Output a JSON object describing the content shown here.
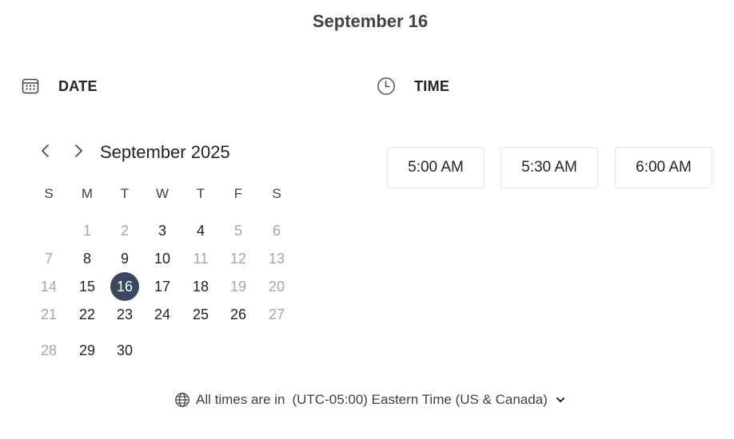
{
  "title": "September 16",
  "date_section": {
    "label": "DATE",
    "icon": "calendar-icon"
  },
  "time_section": {
    "label": "TIME",
    "icon": "clock-icon"
  },
  "calendar": {
    "month_label": "September 2025",
    "prev_icon": "chevron-left-icon",
    "next_icon": "chevron-right-icon",
    "weekdays": [
      "S",
      "M",
      "T",
      "W",
      "T",
      "F",
      "S"
    ],
    "weeks": [
      [
        null,
        {
          "d": "1",
          "s": "unavailable"
        },
        {
          "d": "2",
          "s": "unavailable"
        },
        {
          "d": "3",
          "s": "available"
        },
        {
          "d": "4",
          "s": "available"
        },
        {
          "d": "5",
          "s": "unavailable"
        },
        {
          "d": "6",
          "s": "unavailable"
        }
      ],
      [
        {
          "d": "7",
          "s": "unavailable"
        },
        {
          "d": "8",
          "s": "available"
        },
        {
          "d": "9",
          "s": "available"
        },
        {
          "d": "10",
          "s": "available"
        },
        {
          "d": "11",
          "s": "unavailable"
        },
        {
          "d": "12",
          "s": "unavailable"
        },
        {
          "d": "13",
          "s": "unavailable"
        }
      ],
      [
        {
          "d": "14",
          "s": "unavailable"
        },
        {
          "d": "15",
          "s": "available"
        },
        {
          "d": "16",
          "s": "selected"
        },
        {
          "d": "17",
          "s": "available"
        },
        {
          "d": "18",
          "s": "available"
        },
        {
          "d": "19",
          "s": "unavailable"
        },
        {
          "d": "20",
          "s": "unavailable"
        }
      ],
      [
        {
          "d": "21",
          "s": "unavailable"
        },
        {
          "d": "22",
          "s": "available"
        },
        {
          "d": "23",
          "s": "available"
        },
        {
          "d": "24",
          "s": "available"
        },
        {
          "d": "25",
          "s": "available"
        },
        {
          "d": "26",
          "s": "available"
        },
        {
          "d": "27",
          "s": "unavailable"
        }
      ],
      [
        {
          "d": "28",
          "s": "unavailable"
        },
        {
          "d": "29",
          "s": "available"
        },
        {
          "d": "30",
          "s": "available"
        },
        null,
        null,
        null,
        null
      ]
    ]
  },
  "time_slots": [
    "5:00 AM",
    "5:30 AM",
    "6:00 AM"
  ],
  "timezone": {
    "prefix": "All times are in",
    "value": "(UTC-05:00) Eastern Time (US & Canada)",
    "icon": "globe-icon",
    "dropdown_icon": "chevron-down-icon"
  },
  "colors": {
    "selected_bg": "#3b4660",
    "available_text": "#242424",
    "unavailable_text": "#a6a6a6",
    "slot_border": "#e6e6e6"
  }
}
